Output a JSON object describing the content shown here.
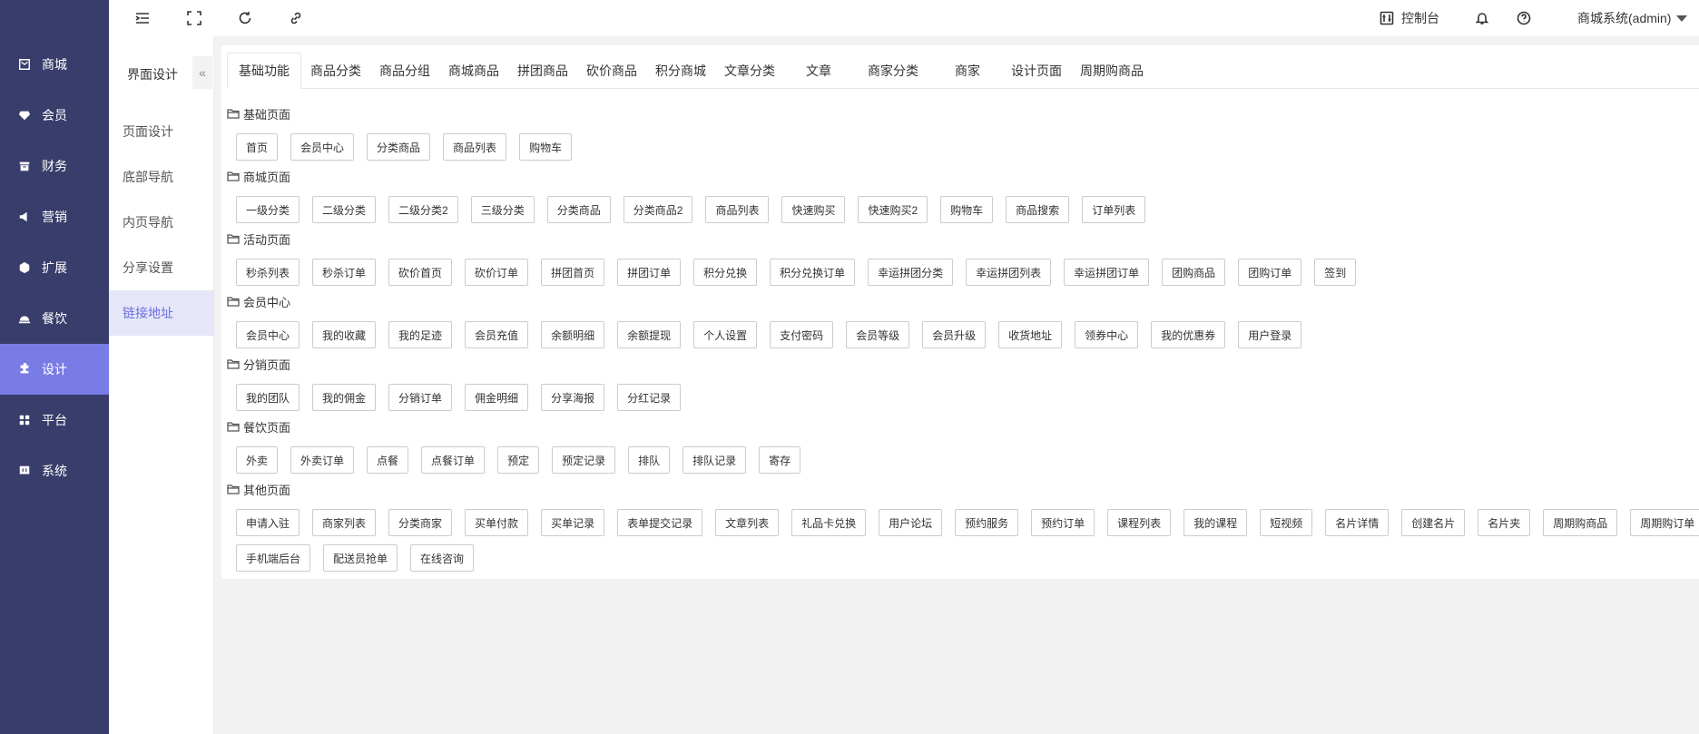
{
  "main_nav": [
    {
      "label": "商城",
      "icon": "shop-icon"
    },
    {
      "label": "会员",
      "icon": "member-icon"
    },
    {
      "label": "财务",
      "icon": "finance-icon"
    },
    {
      "label": "营销",
      "icon": "marketing-icon"
    },
    {
      "label": "扩展",
      "icon": "extension-icon"
    },
    {
      "label": "餐饮",
      "icon": "dining-icon"
    },
    {
      "label": "设计",
      "icon": "design-icon",
      "active": true
    },
    {
      "label": "平台",
      "icon": "platform-icon"
    },
    {
      "label": "系统",
      "icon": "system-icon"
    }
  ],
  "header": {
    "control_panel": "控制台",
    "account": "商城系统(admin)"
  },
  "sub_nav": {
    "title": "界面设计",
    "collapse_glyph": "«",
    "items": [
      "页面设计",
      "底部导航",
      "内页导航",
      "分享设置",
      "链接地址"
    ],
    "active_index": 4
  },
  "tabs": [
    "基础功能",
    "商品分类",
    "商品分组",
    "商城商品",
    "拼团商品",
    "砍价商品",
    "积分商城",
    "文章分类",
    "文章",
    "商家分类",
    "商家",
    "设计页面",
    "周期购商品"
  ],
  "sections": [
    {
      "title": "基础页面",
      "links": [
        "首页",
        "会员中心",
        "分类商品",
        "商品列表",
        "购物车"
      ]
    },
    {
      "title": "商城页面",
      "links": [
        "一级分类",
        "二级分类",
        "二级分类2",
        "三级分类",
        "分类商品",
        "分类商品2",
        "商品列表",
        "快速购买",
        "快速购买2",
        "购物车",
        "商品搜索",
        "订单列表"
      ]
    },
    {
      "title": "活动页面",
      "links": [
        "秒杀列表",
        "秒杀订单",
        "砍价首页",
        "砍价订单",
        "拼团首页",
        "拼团订单",
        "积分兑换",
        "积分兑换订单",
        "幸运拼团分类",
        "幸运拼团列表",
        "幸运拼团订单",
        "团购商品",
        "团购订单",
        "签到"
      ]
    },
    {
      "title": "会员中心",
      "links": [
        "会员中心",
        "我的收藏",
        "我的足迹",
        "会员充值",
        "余额明细",
        "余额提现",
        "个人设置",
        "支付密码",
        "会员等级",
        "会员升级",
        "收货地址",
        "领券中心",
        "我的优惠券",
        "用户登录"
      ]
    },
    {
      "title": "分销页面",
      "links": [
        "我的团队",
        "我的佣金",
        "分销订单",
        "佣金明细",
        "分享海报",
        "分红记录"
      ]
    },
    {
      "title": "餐饮页面",
      "links": [
        "外卖",
        "外卖订单",
        "点餐",
        "点餐订单",
        "预定",
        "预定记录",
        "排队",
        "排队记录",
        "寄存"
      ]
    },
    {
      "title": "其他页面",
      "links": [
        "申请入驻",
        "商家列表",
        "分类商家",
        "买单付款",
        "买单记录",
        "表单提交记录",
        "文章列表",
        "礼品卡兑换",
        "用户论坛",
        "预约服务",
        "预约订单",
        "课程列表",
        "我的课程",
        "短视频",
        "名片详情",
        "创建名片",
        "名片夹",
        "周期购商品",
        "周期购订单"
      ],
      "extra_links": [
        "手机端后台",
        "配送员抢单",
        "在线咨询"
      ]
    }
  ]
}
